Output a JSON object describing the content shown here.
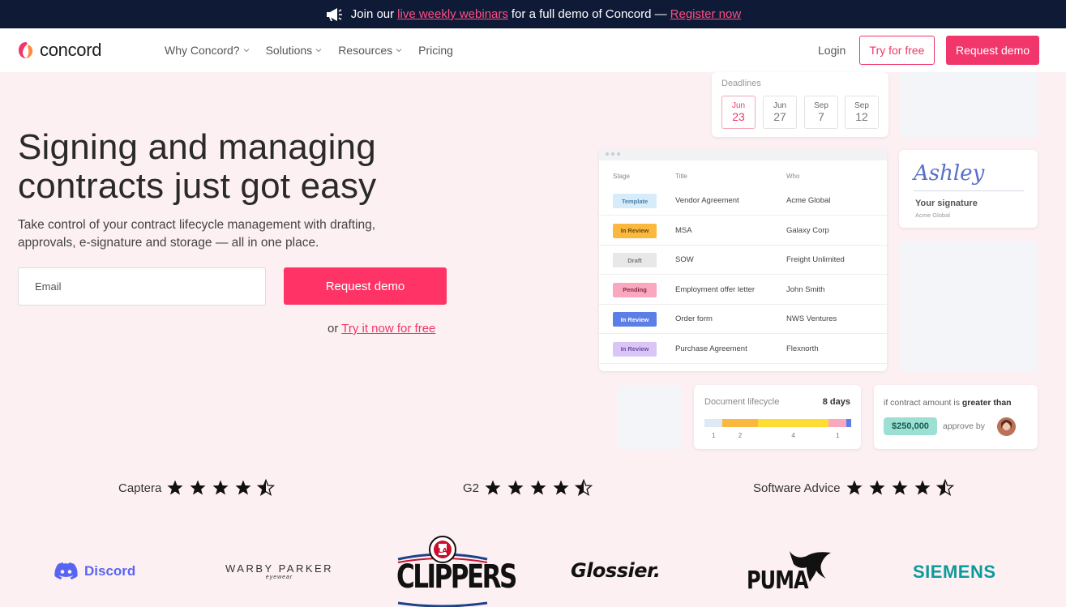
{
  "banner": {
    "prefix": "Join our",
    "link1": "live weekly webinars",
    "middle": "for a full demo of Concord —",
    "link2": "Register now"
  },
  "nav": {
    "logo": "concord",
    "menu": [
      {
        "label": "Why Concord?",
        "dropdown": true
      },
      {
        "label": "Solutions",
        "dropdown": true
      },
      {
        "label": "Resources",
        "dropdown": true
      },
      {
        "label": "Pricing",
        "dropdown": false
      }
    ],
    "login": "Login",
    "try_free": "Try for free",
    "request_demo": "Request demo"
  },
  "hero": {
    "title": "Signing and managing contracts just got easy",
    "subtitle": "Take control of your contract lifecycle management with drafting, approvals, e-signature and storage — all in one place.",
    "email_placeholder": "Email",
    "cta": "Request demo",
    "or": "or",
    "try_link": "Try it now for free"
  },
  "deadlines": {
    "label": "Deadlines",
    "items": [
      {
        "month": "Jun",
        "day": "23",
        "active": true
      },
      {
        "month": "Jun",
        "day": "27",
        "active": false
      },
      {
        "month": "Sep",
        "day": "7",
        "active": false
      },
      {
        "month": "Sep",
        "day": "12",
        "active": false
      }
    ]
  },
  "contracts_table": {
    "headers": {
      "stage": "Stage",
      "title": "Title",
      "who": "Who"
    },
    "rows": [
      {
        "stage": "Template",
        "title": "Vendor Agreement",
        "who": "Acme Global",
        "bg": "#d6ecfb",
        "fg": "#4a7fa8"
      },
      {
        "stage": "In Review",
        "title": "MSA",
        "who": "Galaxy Corp",
        "bg": "#fbb83f",
        "fg": "#6b4a08"
      },
      {
        "stage": "Draft",
        "title": "SOW",
        "who": "Freight Unlimited",
        "bg": "#e8e8e8",
        "fg": "#777777"
      },
      {
        "stage": "Pending",
        "title": "Employment offer letter",
        "who": "John Smith",
        "bg": "#f9a8c0",
        "fg": "#8a2848"
      },
      {
        "stage": "In Review",
        "title": "Order form",
        "who": "NWS Ventures",
        "bg": "#5b7fe6",
        "fg": "#ffffff"
      },
      {
        "stage": "In Review",
        "title": "Purchase Agreement",
        "who": "Flexnorth",
        "bg": "#d9c6f7",
        "fg": "#6a4aa0"
      }
    ]
  },
  "signature": {
    "name_script": "Ashley",
    "label": "Your signature",
    "company": "Acme Global"
  },
  "lifecycle": {
    "label": "Document lifecycle",
    "days": "8 days",
    "segments": [
      {
        "value": 1,
        "color": "#dde9f5"
      },
      {
        "value": 2,
        "color": "#fbb83f"
      },
      {
        "value": 4,
        "color": "#fddc33"
      },
      {
        "value": 1,
        "color": "#f9a8c0"
      }
    ],
    "end_color": "#5b7fe6",
    "ticks": [
      "1",
      "2",
      "4",
      "1"
    ]
  },
  "approval": {
    "prefix": "if contract amount is",
    "bold": "greater than",
    "amount": "$250,000",
    "approve_by": "approve by"
  },
  "ratings": [
    {
      "source": "Captera",
      "stars": 4.5
    },
    {
      "source": "G2",
      "stars": 4.5
    },
    {
      "source": "Software Advice",
      "stars": 4.5
    }
  ],
  "logos": {
    "discord": "Discord",
    "warby_main": "WARBY PARKER",
    "warby_sub": "eyewear",
    "clippers": "CLIPPERS",
    "glossier": "Glossier.",
    "puma": "PUMA",
    "siemens": "SIEMENS"
  },
  "colors": {
    "brand_pink": "#f0366a",
    "banner_bg": "#0f1a36",
    "page_bg": "#fdf0f2"
  }
}
